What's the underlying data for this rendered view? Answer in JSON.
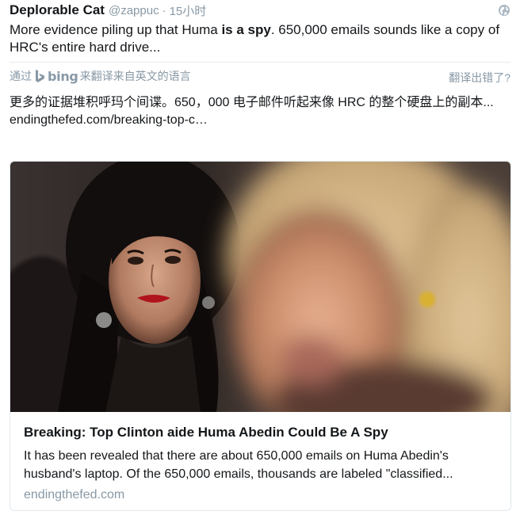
{
  "tweet": {
    "author_name": "Deplorable Cat",
    "handle": "@zappuc",
    "separator": "·",
    "time": "15小时",
    "text_before": "More evidence piling up that Huma ",
    "text_bold": "is a spy",
    "text_after": ". 650,000 emails sounds like a copy of HRC's entire hard drive...",
    "globe_icon": "globe-icon"
  },
  "translation": {
    "via_label": "通过",
    "bing_label": "bing",
    "source_label": "来翻译来自英文的语言",
    "wrong_label": "翻译出错了?",
    "translated_text": "更多的证据堆积呼玛个间谍。650，000 电子邮件听起来像 HRC 的整个硬盘上的副本...",
    "link_text": "endingthefed.com/breaking-top-c…"
  },
  "card": {
    "title": "Breaking: Top Clinton aide Huma Abedin Could Be A Spy",
    "description": "It has been revealed that there are about 650,000 emails on Huma Abedin's husband's laptop. Of the 650,000 emails, thousands are labeled \"classified...",
    "domain": "endingthefed.com"
  },
  "colors": {
    "text": "#14171a",
    "muted": "#8899a6",
    "border": "#e1e8ed"
  }
}
